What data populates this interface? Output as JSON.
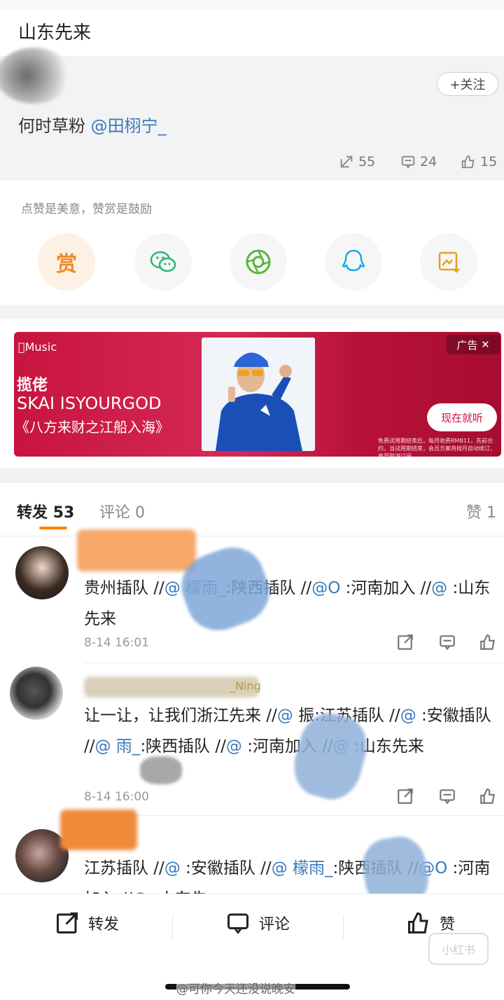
{
  "header": {
    "title": "山东先来"
  },
  "quoted_post": {
    "follow_label": "+关注",
    "text_prefix": "何时草粉 ",
    "mention": "@田栩宁_",
    "stats": {
      "share": "55",
      "comment": "24",
      "like": "15"
    }
  },
  "reward": {
    "tip": "点赞是美意，赞赏是鼓励",
    "reward_label": "赏"
  },
  "ad": {
    "brand": "Music",
    "line1": "揽佬",
    "line2": "SKAI ISYOURGOD",
    "line3": "《八方来财之江船入海》",
    "tag": "广告",
    "cta": "现在就听",
    "fine_print": "免费试用期结束后，每月收费RMB11，先前合约，当试用期结束，会员方案将按月自动续订，直至取消订阅。"
  },
  "tabs": {
    "repost_label": "转发",
    "repost_count": "53",
    "comment_label": "评论",
    "comment_count": "0",
    "like_label": "赞",
    "like_count": "1"
  },
  "reposts": [
    {
      "segments": [
        {
          "t": "贵州插队 //",
          "m": false
        },
        {
          "t": "@",
          "m": true
        },
        {
          "t": "         ",
          "m": false
        },
        {
          "t": "檬雨_",
          "m": true
        },
        {
          "t": ":陕西插队 //",
          "m": false
        },
        {
          "t": "@O",
          "m": true
        },
        {
          "t": "      ",
          "m": false
        },
        {
          "t": ":河",
          "m": false
        },
        {
          "t": "南加入 //",
          "m": false
        },
        {
          "t": "@",
          "m": true
        },
        {
          "t": "            :山东先来",
          "m": false
        }
      ],
      "time": "8-14 16:01"
    },
    {
      "segments": [
        {
          "t": "让一让，让我们浙江先来 //",
          "m": false
        },
        {
          "t": "@",
          "m": true
        },
        {
          "t": "        振",
          "m": false
        },
        {
          "t": ":江苏插队 //",
          "m": false
        },
        {
          "t": "@",
          "m": true
        },
        {
          "t": "       ",
          "m": false
        },
        {
          "t": ":安徽插队 //",
          "m": false
        },
        {
          "t": "@",
          "m": true
        },
        {
          "t": "        雨_",
          "m": true
        },
        {
          "t": ":陕西插队 //",
          "m": false
        },
        {
          "t": "@",
          "m": true
        },
        {
          "t": "       ",
          "m": false
        },
        {
          "t": ":河南加入 //",
          "m": false
        },
        {
          "t": "@",
          "m": true
        },
        {
          "t": "          :山东先来",
          "m": false
        }
      ],
      "name_suffix": "_Ning",
      "time": "8-14 16:00"
    },
    {
      "segments": [
        {
          "t": "江苏插队 //",
          "m": false
        },
        {
          "t": "@",
          "m": true
        },
        {
          "t": "        ",
          "m": false
        },
        {
          "t": ":安徽插队 //",
          "m": false
        },
        {
          "t": "@",
          "m": true
        },
        {
          "t": "         檬雨_",
          "m": true
        },
        {
          "t": ":陕",
          "m": false
        },
        {
          "t": "西插队 //",
          "m": false
        },
        {
          "t": "@O",
          "m": true
        },
        {
          "t": "      ",
          "m": false
        },
        {
          "t": ":河南加入 //",
          "m": false
        },
        {
          "t": "@",
          "m": true
        },
        {
          "t": "         :山东先",
          "m": false
        }
      ],
      "time": ""
    }
  ],
  "bottom_bar": {
    "repost": "转发",
    "comment": "评论",
    "like": "赞",
    "watermark": "小红书",
    "credit": "@可你今天还没说晚安"
  },
  "colors": {
    "accent_orange": "#ff8200",
    "mention_blue": "#3a7ab8",
    "ad_red": "#c8143f"
  }
}
